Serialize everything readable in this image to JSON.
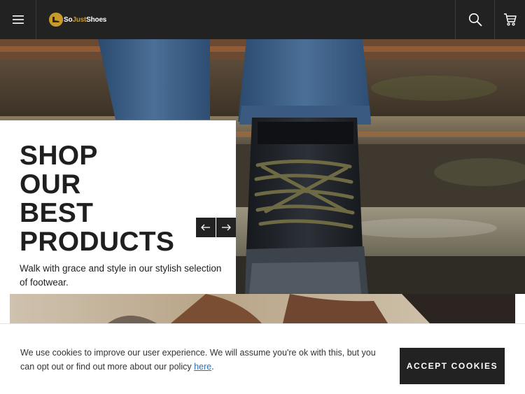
{
  "header": {
    "logo": {
      "part1": "So",
      "part2": "Just",
      "part3": "Shoes"
    },
    "icons": {
      "menu": "hamburger-menu-icon",
      "search": "search-icon",
      "cart": "cart-icon"
    }
  },
  "hero": {
    "title_lines": [
      "SHOP",
      "OUR",
      "BEST",
      "PRODUCTS"
    ],
    "subtitle": "Walk with grace and style in our stylish selection of footwear.",
    "icons": {
      "prev": "arrow-left-icon",
      "next": "arrow-right-icon"
    }
  },
  "cookie": {
    "text": "We use cookies to improve our user experience. We will assume you're ok with this, but you can opt out or find out more about our policy ",
    "link_text": "here",
    "after_link": ".",
    "button_label": "ACCEPT COOKIES"
  },
  "colors": {
    "header_bg": "#222222",
    "logo_gold": "#c89a2a",
    "link_blue": "#2b6fb6",
    "button_bg": "#222222"
  }
}
